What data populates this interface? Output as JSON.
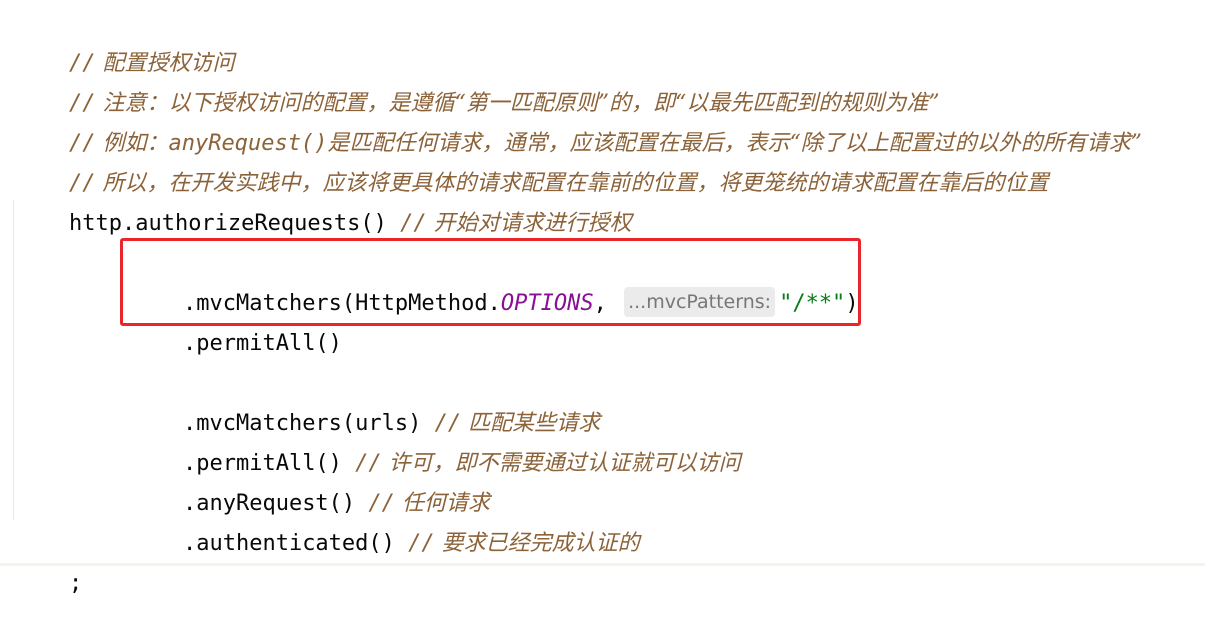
{
  "code": {
    "comment_slashes": "//",
    "line1_comment": " 配置授权访问",
    "line2_comment": " 注意：以下授权访问的配置，是遵循“第一匹配原则”的，即“以最先匹配到的规则为准”",
    "line3_comment_prefix": " 例如：",
    "line3_code": "anyRequest()",
    "line3_comment_suffix": "是匹配任何请求，通常，应该配置在最后，表示“除了以上配置过的以外的所有请求”",
    "line4_comment": " 所以，在开发实践中，应该将更具体的请求配置在靠前的位置，将更笼统的请求配置在靠后的位置",
    "line5_code": "http.authorizeRequests() ",
    "line5_comment": " 开始对请求进行授权",
    "line6_code_prefix": ".mvcMatchers(HttpMethod.",
    "line6_static": "OPTIONS",
    "line6_comma": ",",
    "line6_hint": "...mvcPatterns:",
    "line6_string": "\"/**\"",
    "line6_close": ")",
    "line7_code": ".permitAll()",
    "line8_code": ".mvcMatchers(urls) ",
    "line8_comment": " 匹配某些请求",
    "line9_code": ".permitAll() ",
    "line9_comment": " 许可，即不需要通过认证就可以访问",
    "line10_code": ".anyRequest() ",
    "line10_comment": " 任何请求",
    "line11_code": ".authenticated() ",
    "line11_comment": " 要求已经完成认证的",
    "line12_code": ";"
  }
}
